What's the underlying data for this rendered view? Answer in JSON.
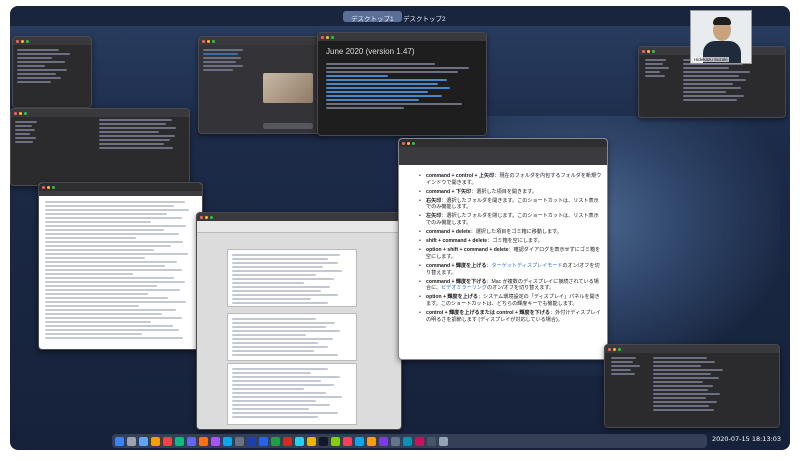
{
  "spaces": [
    "デスクトップ1",
    "デスクトップ2"
  ],
  "active_space": 0,
  "clock": "2020-07-15  18:13:03",
  "video_call": {
    "name": "Hidekazu Suzuki"
  },
  "release_notes": {
    "title": "June 2020 (version 1.47)"
  },
  "shortcut_doc": {
    "items": [
      {
        "key": "command + control + 上矢印",
        "desc": "：現在のフォルダを内包するフォルダを新規ウインドウで開きます。",
        "link": ""
      },
      {
        "key": "command + 下矢印",
        "desc": "：選択した項目を開きます。",
        "link": ""
      },
      {
        "key": "右矢印",
        "desc": "：選択したフォルダを開きます。このショートカットは、リスト表示でのみ機能します。",
        "link": ""
      },
      {
        "key": "左矢印",
        "desc": "：選択したフォルダを閉じます。このショートカットは、リスト表示でのみ機能します。",
        "link": ""
      },
      {
        "key": "command + delete",
        "desc": "：選択した項目をゴミ箱に移動します。",
        "link": ""
      },
      {
        "key": "shift + command + delete",
        "desc": "：ゴミ箱を空にします。",
        "link": ""
      },
      {
        "key": "option + shift + command + delete",
        "desc": "：確認ダイアログを表示せずにゴミ箱を空にします。",
        "link": ""
      },
      {
        "key": "command + 輝度を上げる",
        "desc": "のオン/オフを切り替えます。",
        "link": "ターゲットディスプレイモード"
      },
      {
        "key": "command + 輝度を下げる",
        "desc": "：Mac が複数のディスプレイに接続されている場合に、",
        "link": "ビデオミラーリング",
        "desc2": "のオン/オフを切り替えます。"
      },
      {
        "key": "option + 輝度を上げる",
        "desc": "：システム環境設定の「ディスプレイ」パネルを開きます。このショートカットは、どちらの輝度キーでも機能します。",
        "link": ""
      },
      {
        "key": "control + 輝度を上げるまたは control + 輝度を下げる",
        "desc": "：外付けディスプレイの明るさを調節します (ディスプレイが対応している場合)。",
        "link": ""
      }
    ]
  },
  "colors": {
    "accent": "#5a6f95",
    "link": "#2a6fd1",
    "desktop": "#1c2b49"
  }
}
